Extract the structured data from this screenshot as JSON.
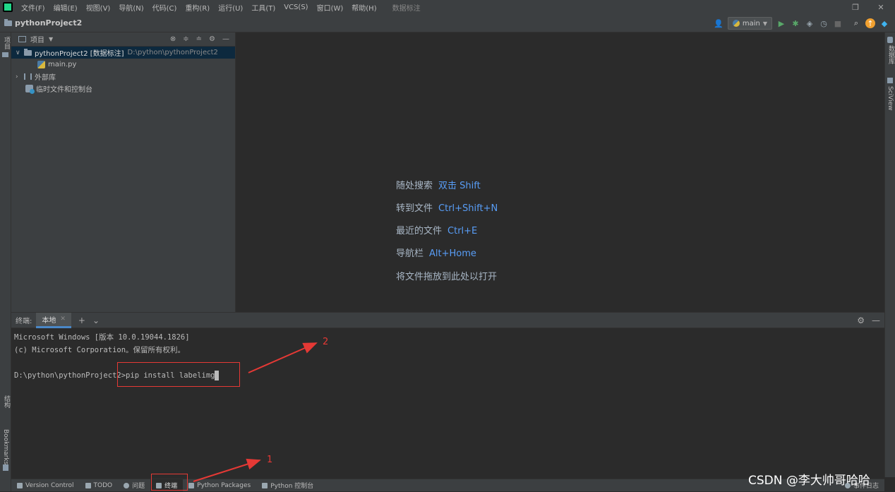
{
  "menubar": {
    "items": [
      "文件(F)",
      "编辑(E)",
      "视图(V)",
      "导航(N)",
      "代码(C)",
      "重构(R)",
      "运行(U)",
      "工具(T)",
      "VCS(S)",
      "窗口(W)",
      "帮助(H)"
    ],
    "title": "数据标注"
  },
  "navbar": {
    "project": "pythonProject2",
    "run_config": "main"
  },
  "left_strip": {
    "project": "项目",
    "structure": "结构",
    "bookmarks": "Bookmarks"
  },
  "right_strip": {
    "database": "数据库",
    "sciview": "SciView"
  },
  "project_panel": {
    "title": "项目",
    "tree": [
      {
        "name": "pythonProject2 [数据标注]",
        "path": "D:\\python\\pythonProject2"
      },
      {
        "name": "main.py"
      },
      {
        "name": "外部库"
      },
      {
        "name": "临时文件和控制台"
      }
    ]
  },
  "editor_hints": [
    {
      "label": "随处搜索",
      "key": "双击 Shift"
    },
    {
      "label": "转到文件",
      "key": "Ctrl+Shift+N"
    },
    {
      "label": "最近的文件",
      "key": "Ctrl+E"
    },
    {
      "label": "导航栏",
      "key": "Alt+Home"
    },
    {
      "label": "将文件拖放到此处以打开",
      "key": ""
    }
  ],
  "terminal": {
    "label": "终端:",
    "tab": "本地",
    "lines": [
      "Microsoft Windows [版本 10.0.19044.1826]",
      "(c) Microsoft Corporation。保留所有权利。",
      ""
    ],
    "prompt": "D:\\python\\pythonProject2>",
    "command": "pip install labelimg"
  },
  "statusbar": {
    "items": [
      "Version Control",
      "TODO",
      "问题",
      "终端",
      "Python Packages",
      "Python 控制台"
    ],
    "event_log": "事件日志"
  },
  "annotations": {
    "one": "1",
    "two": "2"
  },
  "watermark": "CSDN @李大帅哥哈哈"
}
